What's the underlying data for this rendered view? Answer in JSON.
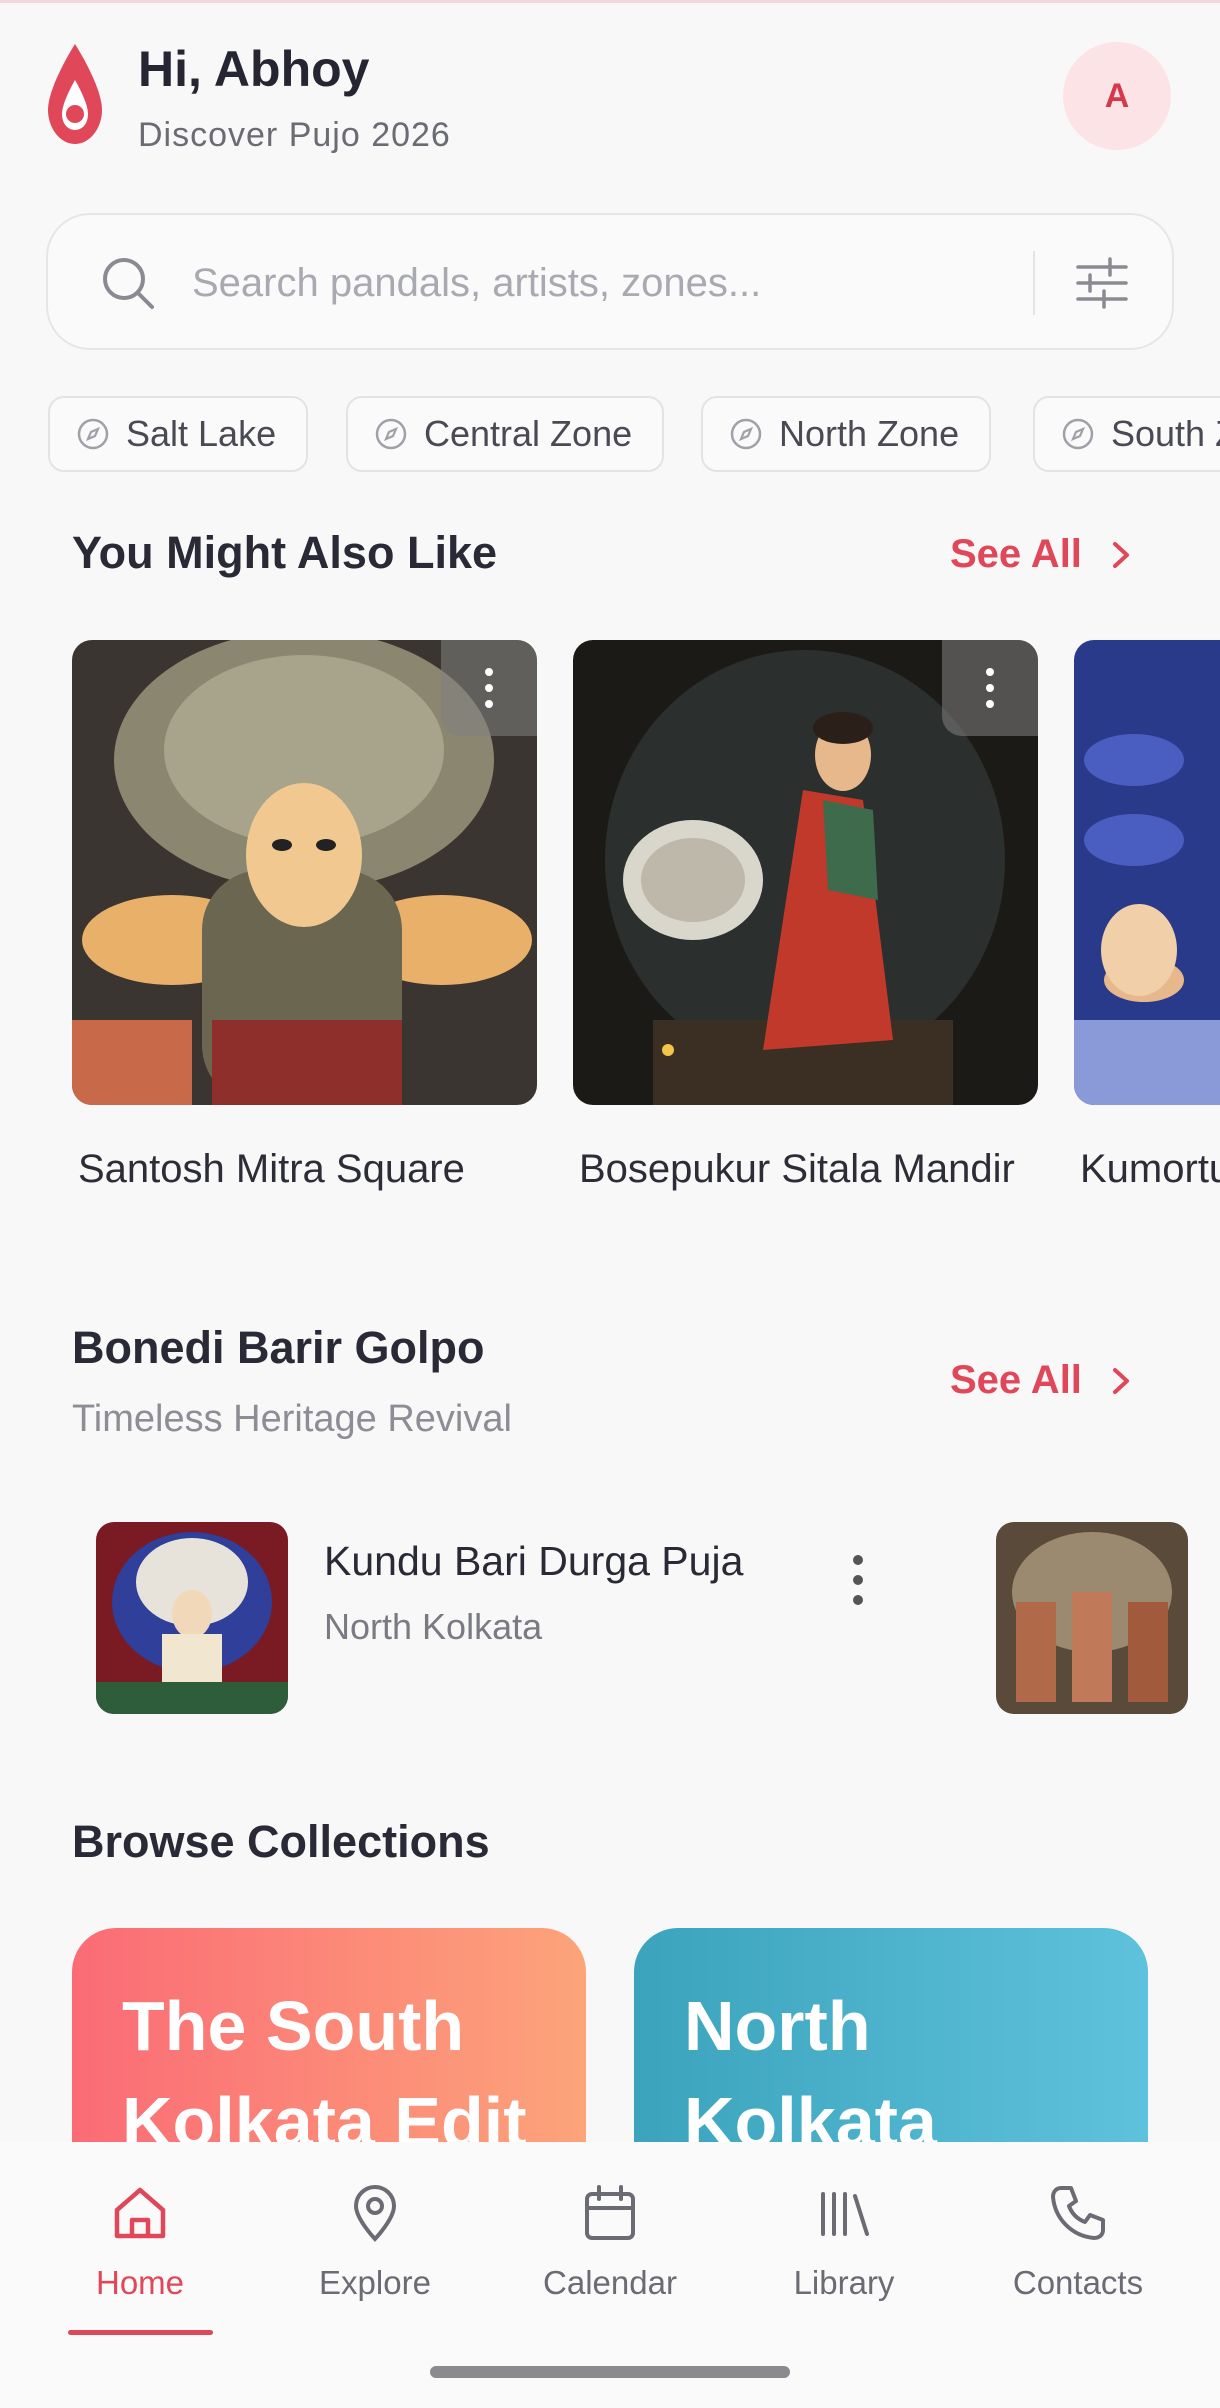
{
  "header": {
    "greeting": "Hi, Abhoy",
    "subtitle": "Discover Pujo 2026",
    "avatar_initial": "A"
  },
  "search": {
    "placeholder": "Search pandals, artists, zones..."
  },
  "zones": [
    {
      "label": "Salt Lake"
    },
    {
      "label": "Central Zone"
    },
    {
      "label": "North Zone"
    },
    {
      "label": "South Zone"
    }
  ],
  "recommend": {
    "title": "You Might Also Like",
    "see_all": "See All",
    "cards": [
      {
        "title": "Santosh Mitra Square"
      },
      {
        "title": "Bosepukur Sitala Mandir"
      },
      {
        "title": "Kumortuli"
      }
    ]
  },
  "bonedi": {
    "title": "Bonedi Barir Golpo",
    "subtitle": "Timeless Heritage Revival",
    "see_all": "See All",
    "items": [
      {
        "title": "Kundu Bari Durga Puja",
        "location": "North Kolkata"
      }
    ]
  },
  "collections": {
    "title": "Browse Collections",
    "items": [
      {
        "label": "The South Kolkata Edit",
        "color_start": "#fb6b76",
        "color_end": "#fca47a"
      },
      {
        "label": "North Kolkata",
        "color_start": "#3ba3bc",
        "color_end": "#5fc2dc"
      }
    ]
  },
  "nav": {
    "active": "Home",
    "items": [
      {
        "label": "Home",
        "icon": "home-icon"
      },
      {
        "label": "Explore",
        "icon": "map-pin-icon"
      },
      {
        "label": "Calendar",
        "icon": "calendar-icon"
      },
      {
        "label": "Library",
        "icon": "library-icon"
      },
      {
        "label": "Contacts",
        "icon": "phone-icon"
      }
    ]
  },
  "colors": {
    "accent": "#e0485a",
    "background": "#f8f8f9"
  }
}
